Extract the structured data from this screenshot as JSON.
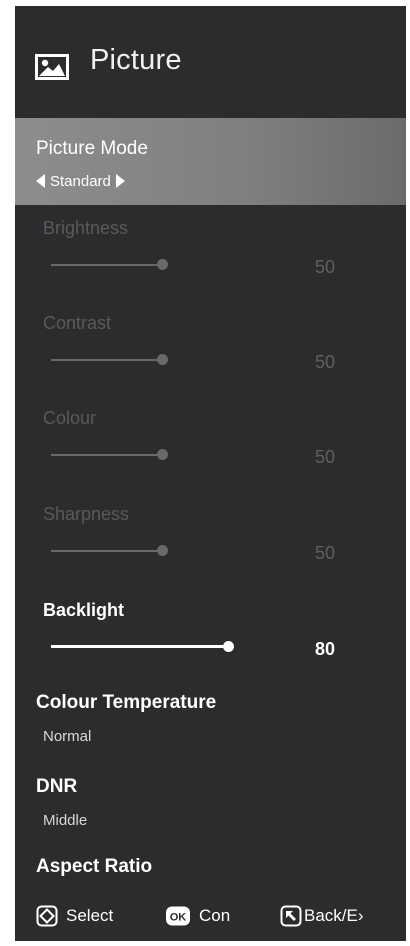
{
  "header": {
    "title": "Picture",
    "icon": "picture-icon"
  },
  "picture_mode": {
    "label": "Picture Mode",
    "value": "Standard"
  },
  "sliders": [
    {
      "label": "Brightness",
      "value": "50",
      "level": 0.5,
      "enabled": false
    },
    {
      "label": "Contrast",
      "value": "50",
      "level": 0.5,
      "enabled": false
    },
    {
      "label": "Colour",
      "value": "50",
      "level": 0.5,
      "enabled": false
    },
    {
      "label": "Sharpness",
      "value": "50",
      "level": 0.5,
      "enabled": false
    },
    {
      "label": "Backlight",
      "value": "80",
      "level": 0.8,
      "enabled": true
    }
  ],
  "options": [
    {
      "label": "Colour Temperature",
      "value": "Normal"
    },
    {
      "label": "DNR",
      "value": "Middle"
    },
    {
      "label": "Aspect Ratio",
      "value": ""
    }
  ],
  "footer": {
    "select_label": "Select",
    "confirm_label": "Con",
    "back_label": "Back/E›",
    "select_icon": "dpad-icon",
    "confirm_icon": "ok-icon",
    "back_icon": "back-icon"
  },
  "colors": {
    "panel_bg": "#2b2c2e",
    "highlight": "#8d8d8e",
    "text": "#ffffff",
    "disabled": "#595a5c"
  }
}
